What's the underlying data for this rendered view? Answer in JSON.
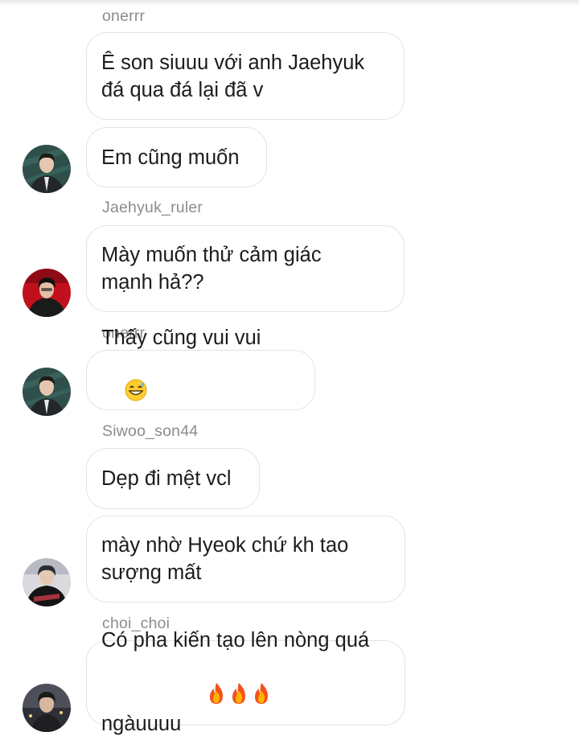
{
  "messages": [
    {
      "sender": "onerrr",
      "text": "Ê son siuuu với anh Jaehyuk\nđá qua đá lại đã v"
    },
    {
      "text": "Em cũng muốn",
      "avatar": "avatar-onerrr-icon"
    },
    {
      "sender": "Jaehyuk_ruler",
      "text": "Mày muốn thử cảm giác\nmạnh hả??",
      "avatar": "avatar-jaehyuk-icon"
    },
    {
      "sender": "onerrr",
      "text": "Thấy cũng vui vui",
      "emoji": "grinning-sweat-emoji",
      "avatar": "avatar-onerrr-icon"
    },
    {
      "sender": "Siwoo_son44",
      "text": "Dẹp đi mệt vcl"
    },
    {
      "text": "mày nhờ Hyeok chứ kh tao\nsượng mất",
      "avatar": "avatar-siwoo-icon"
    },
    {
      "sender": "choi_choi",
      "text": "Có pha kiến tạo lên nòng quá\nngàuuuu",
      "emoji": "fire-emoji-x3",
      "avatar": "avatar-choi-icon"
    }
  ],
  "colors": {
    "bubble_border": "#e4e4e4",
    "sender_text": "#8c8c8c",
    "message_text": "#1c1c1c",
    "background": "#ffffff"
  }
}
